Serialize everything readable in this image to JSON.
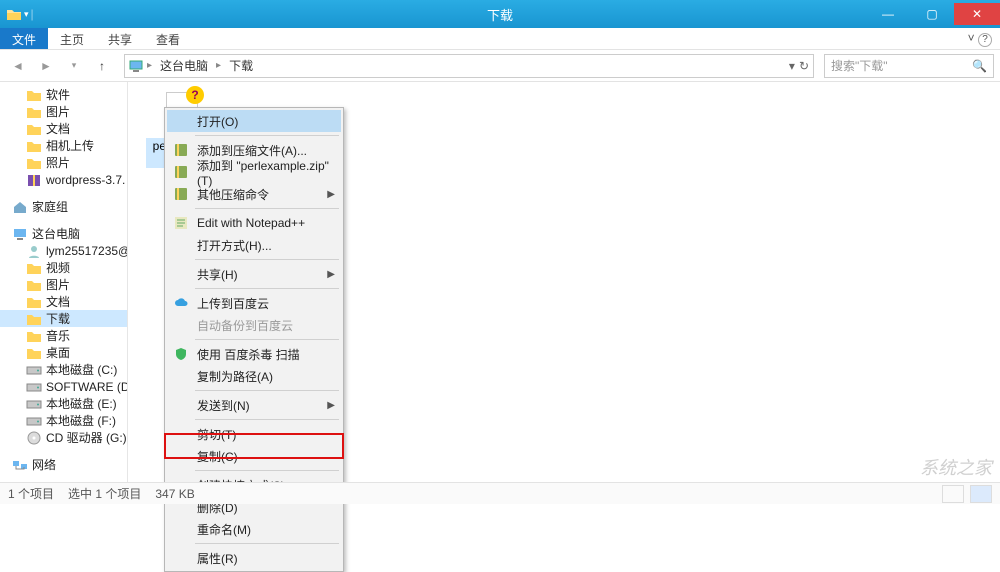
{
  "window": {
    "title": "下载",
    "file_tab": "文件",
    "tabs": [
      "主页",
      "共享",
      "查看"
    ]
  },
  "breadcrumb": {
    "root": "这台电脑",
    "current": "下载"
  },
  "search": {
    "placeholder": "搜索\"下载\""
  },
  "sidebar": {
    "quick": [
      {
        "label": "软件",
        "icon": "folder"
      },
      {
        "label": "图片",
        "icon": "folder"
      },
      {
        "label": "文档",
        "icon": "folder"
      },
      {
        "label": "相机上传",
        "icon": "folder"
      },
      {
        "label": "照片",
        "icon": "folder"
      },
      {
        "label": "wordpress-3.7.",
        "icon": "zip"
      }
    ],
    "homegroup": "家庭组",
    "thispc": {
      "label": "这台电脑",
      "items": [
        {
          "label": "lym25517235@",
          "icon": "user"
        },
        {
          "label": "视频",
          "icon": "folder"
        },
        {
          "label": "图片",
          "icon": "folder"
        },
        {
          "label": "文档",
          "icon": "folder"
        },
        {
          "label": "下载",
          "icon": "folder",
          "selected": true
        },
        {
          "label": "音乐",
          "icon": "folder"
        },
        {
          "label": "桌面",
          "icon": "folder"
        },
        {
          "label": "本地磁盘 (C:)",
          "icon": "drive"
        },
        {
          "label": "SOFTWARE (D:)",
          "icon": "drive"
        },
        {
          "label": "本地磁盘 (E:)",
          "icon": "drive"
        },
        {
          "label": "本地磁盘 (F:)",
          "icon": "drive"
        },
        {
          "label": "CD 驱动器 (G:)",
          "icon": "cd"
        }
      ]
    },
    "network": "网络"
  },
  "file": {
    "name": "perlexample.c"
  },
  "context_menu": [
    {
      "label": "打开(O)",
      "type": "item",
      "highlight": true
    },
    {
      "type": "sep"
    },
    {
      "label": "添加到压缩文件(A)...",
      "type": "item",
      "icon": "rar"
    },
    {
      "label": "添加到 \"perlexample.zip\"(T)",
      "type": "item",
      "icon": "rar"
    },
    {
      "label": "其他压缩命令",
      "type": "item",
      "icon": "rar",
      "sub": true
    },
    {
      "type": "sep"
    },
    {
      "label": "Edit with Notepad++",
      "type": "item",
      "icon": "npp"
    },
    {
      "label": "打开方式(H)...",
      "type": "item"
    },
    {
      "type": "sep"
    },
    {
      "label": "共享(H)",
      "type": "item",
      "sub": true
    },
    {
      "type": "sep"
    },
    {
      "label": "上传到百度云",
      "type": "item",
      "icon": "cloud"
    },
    {
      "label": "自动备份到百度云",
      "type": "item",
      "disabled": true
    },
    {
      "type": "sep"
    },
    {
      "label": "使用 百度杀毒 扫描",
      "type": "item",
      "icon": "shield"
    },
    {
      "label": "复制为路径(A)",
      "type": "item"
    },
    {
      "type": "sep"
    },
    {
      "label": "发送到(N)",
      "type": "item",
      "sub": true
    },
    {
      "type": "sep"
    },
    {
      "label": "剪切(T)",
      "type": "item"
    },
    {
      "label": "复制(C)",
      "type": "item"
    },
    {
      "type": "sep"
    },
    {
      "label": "创建快捷方式(S)",
      "type": "item"
    },
    {
      "label": "删除(D)",
      "type": "item"
    },
    {
      "label": "重命名(M)",
      "type": "item"
    },
    {
      "type": "sep"
    },
    {
      "label": "属性(R)",
      "type": "item",
      "boxed": true
    }
  ],
  "status": {
    "count": "1 个项目",
    "selected": "选中 1 个项目",
    "size": "347 KB"
  },
  "watermark": "系统之家"
}
